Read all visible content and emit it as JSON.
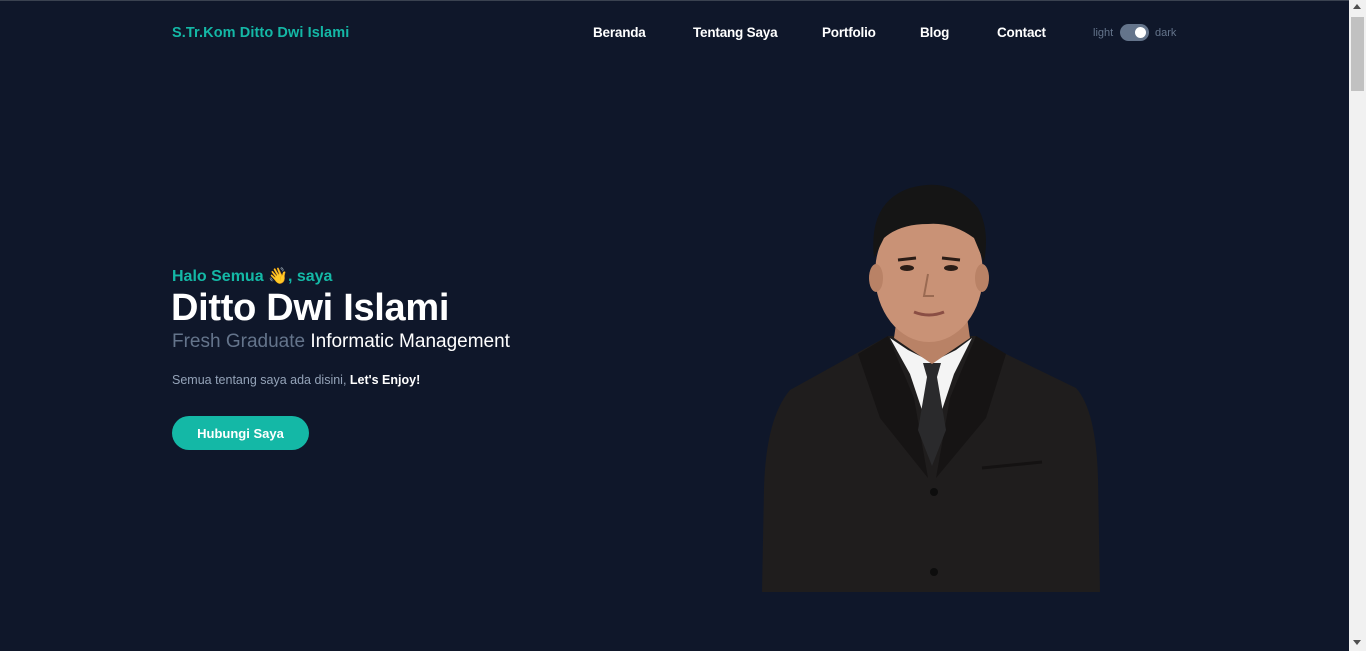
{
  "header": {
    "brand": "S.Tr.Kom Ditto Dwi Islami",
    "nav": [
      "Beranda",
      "Tentang Saya",
      "Portfolio",
      "Blog",
      "Contact"
    ],
    "theme_toggle": {
      "light_label": "light",
      "dark_label": "dark",
      "state": "dark"
    }
  },
  "hero": {
    "greeting": "Halo Semua 👋, saya",
    "name": "Ditto Dwi Islami",
    "role_prefix": "Fresh Graduate",
    "role_main": "Informatic Management",
    "description": "Semua tentang saya ada disini,",
    "description_emphasis": "Let's Enjoy!",
    "cta_label": "Hubungi Saya",
    "photo_icon": "profile-photo"
  },
  "colors": {
    "background": "#0f172a",
    "accent": "#14b8a6",
    "muted": "#64748b",
    "text": "#ffffff"
  }
}
